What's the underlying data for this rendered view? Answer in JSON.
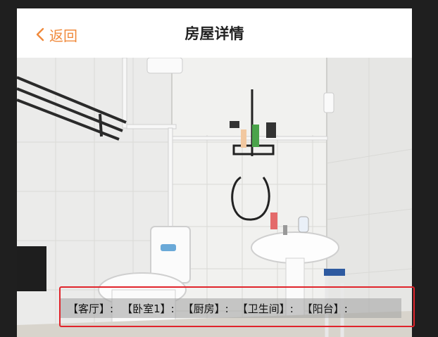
{
  "header": {
    "back_label": "返回",
    "title": "房屋详情"
  },
  "photo": {
    "subject": "bathroom"
  },
  "room_tabs": [
    {
      "label": "【客厅】:"
    },
    {
      "label": "【卧室1】:"
    },
    {
      "label": "【厨房】:"
    },
    {
      "label": "【卫生间】:"
    },
    {
      "label": "【阳台】:"
    }
  ],
  "colors": {
    "accent": "#f08a3c",
    "highlight": "#e0242b"
  }
}
